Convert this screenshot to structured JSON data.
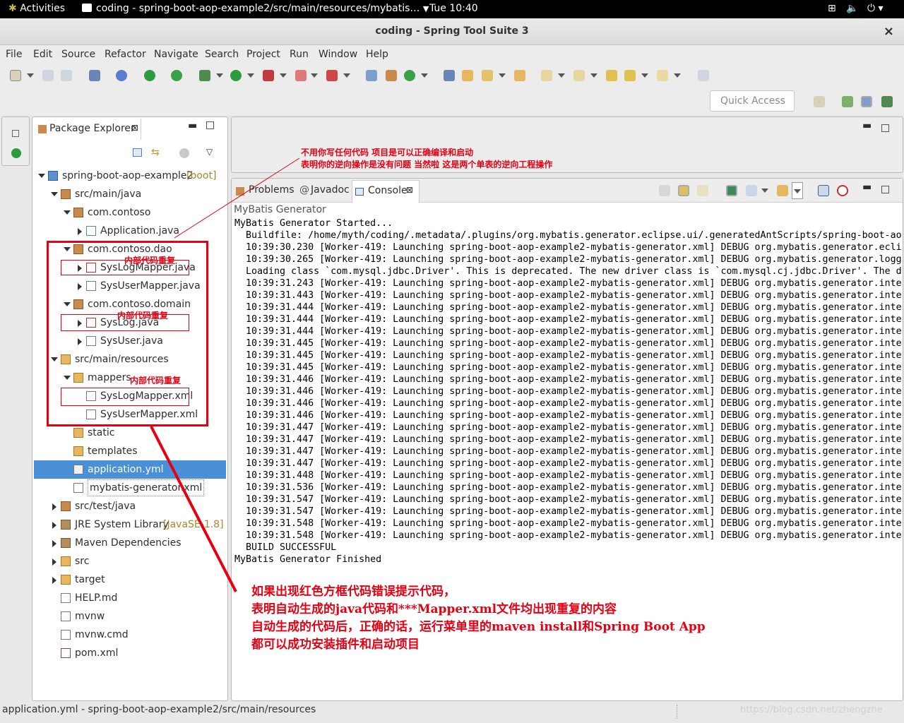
{
  "topbar": {
    "activities": "Activities",
    "window_title": "coding - spring-boot-aop-example2/src/main/resources/mybatis…",
    "clock": "Tue 10:40"
  },
  "window": {
    "title": "coding - Spring Tool Suite 3",
    "close": "×"
  },
  "menu": [
    "File",
    "Edit",
    "Source",
    "Refactor",
    "Navigate",
    "Search",
    "Project",
    "Run",
    "Window",
    "Help"
  ],
  "quick_access_placeholder": "Quick Access",
  "package_explorer": {
    "tab_label": "Package Explorer",
    "project": "spring-boot-aop-example2",
    "project_tag": "[boot]",
    "items": [
      "src/main/java",
      "com.contoso",
      "Application.java",
      "com.contoso.dao",
      "SysLogMapper.java",
      "SysUserMapper.java",
      "com.contoso.domain",
      "SysLog.java",
      "SysUser.java",
      "src/main/resources",
      "mappers",
      "SysLogMapper.xml",
      "SysUserMapper.xml",
      "static",
      "templates",
      "application.yml",
      "mybatis-generator.xml",
      "src/test/java",
      "JRE System Library",
      "Maven Dependencies",
      "src",
      "target",
      "HELP.md",
      "mvnw",
      "mvnw.cmd",
      "pom.xml"
    ],
    "jre_tag": "[JavaSE-1.8]",
    "selected": "application.yml"
  },
  "bottom_tabs": {
    "problems": "Problems",
    "javadoc": "Javadoc",
    "console": "Console"
  },
  "console": {
    "header": "MyBatis Generator",
    "lines": [
      "MyBatis Generator Started...",
      "  Buildfile: /home/myth/coding/.metadata/.plugins/org.mybatis.generator.eclipse.ui/.generatedAntScripts/spring-boot-ao",
      "  10:39:30.230 [Worker-419: Launching spring-boot-aop-example2-mybatis-generator.xml] DEBUG org.mybatis.generator.ecli",
      "  10:39:30.265 [Worker-419: Launching spring-boot-aop-example2-mybatis-generator.xml] DEBUG org.mybatis.generator.logg",
      "  Loading class `com.mysql.jdbc.Driver'. This is deprecated. The new driver class is `com.mysql.cj.jdbc.Driver'. The d",
      "  10:39:31.243 [Worker-419: Launching spring-boot-aop-example2-mybatis-generator.xml] DEBUG org.mybatis.generator.inte",
      "  10:39:31.443 [Worker-419: Launching spring-boot-aop-example2-mybatis-generator.xml] DEBUG org.mybatis.generator.inte",
      "  10:39:31.444 [Worker-419: Launching spring-boot-aop-example2-mybatis-generator.xml] DEBUG org.mybatis.generator.inte",
      "  10:39:31.444 [Worker-419: Launching spring-boot-aop-example2-mybatis-generator.xml] DEBUG org.mybatis.generator.inte",
      "  10:39:31.444 [Worker-419: Launching spring-boot-aop-example2-mybatis-generator.xml] DEBUG org.mybatis.generator.inte",
      "  10:39:31.445 [Worker-419: Launching spring-boot-aop-example2-mybatis-generator.xml] DEBUG org.mybatis.generator.inte",
      "  10:39:31.445 [Worker-419: Launching spring-boot-aop-example2-mybatis-generator.xml] DEBUG org.mybatis.generator.inte",
      "  10:39:31.445 [Worker-419: Launching spring-boot-aop-example2-mybatis-generator.xml] DEBUG org.mybatis.generator.inte",
      "  10:39:31.446 [Worker-419: Launching spring-boot-aop-example2-mybatis-generator.xml] DEBUG org.mybatis.generator.inte",
      "  10:39:31.446 [Worker-419: Launching spring-boot-aop-example2-mybatis-generator.xml] DEBUG org.mybatis.generator.inte",
      "  10:39:31.446 [Worker-419: Launching spring-boot-aop-example2-mybatis-generator.xml] DEBUG org.mybatis.generator.inte",
      "  10:39:31.446 [Worker-419: Launching spring-boot-aop-example2-mybatis-generator.xml] DEBUG org.mybatis.generator.inte",
      "  10:39:31.447 [Worker-419: Launching spring-boot-aop-example2-mybatis-generator.xml] DEBUG org.mybatis.generator.inte",
      "  10:39:31.447 [Worker-419: Launching spring-boot-aop-example2-mybatis-generator.xml] DEBUG org.mybatis.generator.inte",
      "  10:39:31.447 [Worker-419: Launching spring-boot-aop-example2-mybatis-generator.xml] DEBUG org.mybatis.generator.inte",
      "  10:39:31.447 [Worker-419: Launching spring-boot-aop-example2-mybatis-generator.xml] DEBUG org.mybatis.generator.inte",
      "  10:39:31.448 [Worker-419: Launching spring-boot-aop-example2-mybatis-generator.xml] DEBUG org.mybatis.generator.inte",
      "  10:39:31.536 [Worker-419: Launching spring-boot-aop-example2-mybatis-generator.xml] DEBUG org.mybatis.generator.inte",
      "  10:39:31.547 [Worker-419: Launching spring-boot-aop-example2-mybatis-generator.xml] DEBUG org.mybatis.generator.inte",
      "  10:39:31.547 [Worker-419: Launching spring-boot-aop-example2-mybatis-generator.xml] DEBUG org.mybatis.generator.inte",
      "  10:39:31.548 [Worker-419: Launching spring-boot-aop-example2-mybatis-generator.xml] DEBUG org.mybatis.generator.inte",
      "  10:39:31.548 [Worker-419: Launching spring-boot-aop-example2-mybatis-generator.xml] DEBUG org.mybatis.generator.inte",
      "  BUILD SUCCESSFUL",
      "MyBatis Generator Finished"
    ]
  },
  "annotations": {
    "top_line1": "不用你写任何代码   项目是可以正确编译和启动",
    "top_line2": "表明你的逆向操作是没有问题   当然啦  这是两个单表的逆向工程操作",
    "dup1": "内部代码重复",
    "dup2": "内部代码重复",
    "dup3": "内部代码重复",
    "bottom_lines": [
      "如果出现红色方框代码错误提示代码，",
      "表明自动生成的java代码和***Mapper.xml文件均出现重复的内容",
      "自动生成的代码后，正确的话，运行菜单里的maven install和Spring Boot App",
      "都可以成功安装插件和启动项目"
    ]
  },
  "statusbar": {
    "text": "application.yml - spring-boot-aop-example2/src/main/resources"
  },
  "watermark": "https://blog.csdn.net/zhengzhe"
}
